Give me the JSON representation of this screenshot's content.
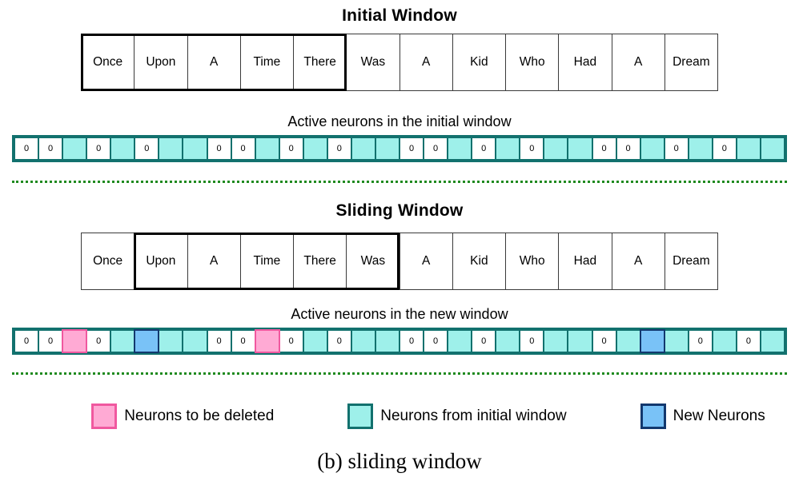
{
  "figure": {
    "caption": "(b) sliding window"
  },
  "colors": {
    "teal_fill": "#9ef0ea",
    "teal_border": "#12716e",
    "pink_fill": "#ffaad4",
    "pink_border": "#f0589f",
    "blue_fill": "#79c2f7",
    "blue_border": "#12386e",
    "divider_green": "#1f8a1f",
    "window_frame": "#000000"
  },
  "initial": {
    "title": "Initial Window",
    "tokens": [
      "Once",
      "Upon",
      "A",
      "Time",
      "There",
      "Was",
      "A",
      "Kid",
      "Who",
      "Had",
      "A",
      "Dream"
    ],
    "window_start_index": 0,
    "window_end_index": 4,
    "neuron_label": "Active neurons in the initial window",
    "neurons": [
      {
        "state": "zero",
        "value": "0"
      },
      {
        "state": "zero",
        "value": "0"
      },
      {
        "state": "teal",
        "value": ""
      },
      {
        "state": "zero",
        "value": "0"
      },
      {
        "state": "teal",
        "value": ""
      },
      {
        "state": "zero",
        "value": "0"
      },
      {
        "state": "teal",
        "value": ""
      },
      {
        "state": "teal",
        "value": ""
      },
      {
        "state": "zero",
        "value": "0"
      },
      {
        "state": "zero",
        "value": "0"
      },
      {
        "state": "teal",
        "value": ""
      },
      {
        "state": "zero",
        "value": "0"
      },
      {
        "state": "teal",
        "value": ""
      },
      {
        "state": "zero",
        "value": "0"
      },
      {
        "state": "teal",
        "value": ""
      },
      {
        "state": "teal",
        "value": ""
      },
      {
        "state": "zero",
        "value": "0"
      },
      {
        "state": "zero",
        "value": "0"
      },
      {
        "state": "teal",
        "value": ""
      },
      {
        "state": "zero",
        "value": "0"
      },
      {
        "state": "teal",
        "value": ""
      },
      {
        "state": "zero",
        "value": "0"
      },
      {
        "state": "teal",
        "value": ""
      },
      {
        "state": "teal",
        "value": ""
      },
      {
        "state": "zero",
        "value": "0"
      },
      {
        "state": "zero",
        "value": "0"
      },
      {
        "state": "teal",
        "value": ""
      },
      {
        "state": "zero",
        "value": "0"
      },
      {
        "state": "teal",
        "value": ""
      },
      {
        "state": "zero",
        "value": "0"
      },
      {
        "state": "teal",
        "value": ""
      },
      {
        "state": "teal",
        "value": ""
      }
    ]
  },
  "sliding": {
    "title": "Sliding Window",
    "tokens": [
      "Once",
      "Upon",
      "A",
      "Time",
      "There",
      "Was",
      "A",
      "Kid",
      "Who",
      "Had",
      "A",
      "Dream"
    ],
    "window_start_index": 1,
    "window_end_index": 5,
    "neuron_label": "Active neurons in the new window",
    "neurons": [
      {
        "state": "zero",
        "value": "0"
      },
      {
        "state": "zero",
        "value": "0"
      },
      {
        "state": "pink",
        "value": ""
      },
      {
        "state": "zero",
        "value": "0"
      },
      {
        "state": "teal",
        "value": ""
      },
      {
        "state": "blue",
        "value": ""
      },
      {
        "state": "teal",
        "value": ""
      },
      {
        "state": "teal",
        "value": ""
      },
      {
        "state": "zero",
        "value": "0"
      },
      {
        "state": "zero",
        "value": "0"
      },
      {
        "state": "pink",
        "value": ""
      },
      {
        "state": "zero",
        "value": "0"
      },
      {
        "state": "teal",
        "value": ""
      },
      {
        "state": "zero",
        "value": "0"
      },
      {
        "state": "teal",
        "value": ""
      },
      {
        "state": "teal",
        "value": ""
      },
      {
        "state": "zero",
        "value": "0"
      },
      {
        "state": "zero",
        "value": "0"
      },
      {
        "state": "teal",
        "value": ""
      },
      {
        "state": "zero",
        "value": "0"
      },
      {
        "state": "teal",
        "value": ""
      },
      {
        "state": "zero",
        "value": "0"
      },
      {
        "state": "teal",
        "value": ""
      },
      {
        "state": "teal",
        "value": ""
      },
      {
        "state": "zero",
        "value": "0"
      },
      {
        "state": "teal",
        "value": ""
      },
      {
        "state": "blue",
        "value": ""
      },
      {
        "state": "teal",
        "value": ""
      },
      {
        "state": "zero",
        "value": "0"
      },
      {
        "state": "teal",
        "value": ""
      },
      {
        "state": "zero",
        "value": "0"
      },
      {
        "state": "teal",
        "value": ""
      }
    ]
  },
  "legend": {
    "items": [
      {
        "swatch": "pink",
        "label": "Neurons to be deleted"
      },
      {
        "swatch": "teal",
        "label": "Neurons from initial window"
      },
      {
        "swatch": "blue",
        "label": "New Neurons"
      }
    ]
  }
}
